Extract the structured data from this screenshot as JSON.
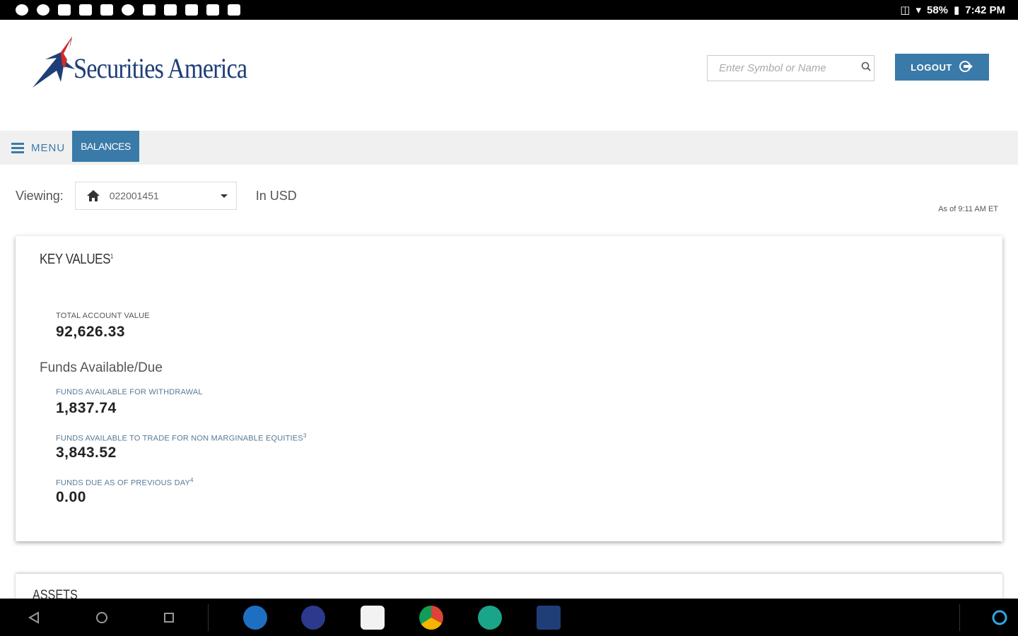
{
  "status_bar": {
    "battery": "58%",
    "time": "7:42 PM"
  },
  "header": {
    "brand": "Securities America",
    "search_placeholder": "Enter Symbol or Name",
    "logout_label": "LOGOUT"
  },
  "nav": {
    "menu_label": "MENU",
    "active_tab": "BALANCES"
  },
  "viewing": {
    "label": "Viewing:",
    "account": "022001451",
    "currency": "In USD",
    "as_of": "As of 9:11 AM ET"
  },
  "key_values": {
    "title": "KEY VALUES",
    "title_sup": "1",
    "total_account_value_label": "TOTAL ACCOUNT VALUE",
    "total_account_value": "92,626.33",
    "funds_heading": "Funds Available/Due",
    "withdrawal_label": "FUNDS AVAILABLE FOR WITHDRAWAL",
    "withdrawal_value": "1,837.74",
    "trade_label": "FUNDS AVAILABLE TO TRADE FOR NON MARGINABLE EQUITIES",
    "trade_sup": "3",
    "trade_value": "3,843.52",
    "due_label": "FUNDS DUE AS OF PREVIOUS DAY",
    "due_sup": "4",
    "due_value": "0.00"
  },
  "assets": {
    "title": "ASSETS"
  },
  "colors": {
    "accent": "#3a7aa8",
    "brand_navy": "#1f3e78",
    "brand_red": "#d42a2a"
  }
}
